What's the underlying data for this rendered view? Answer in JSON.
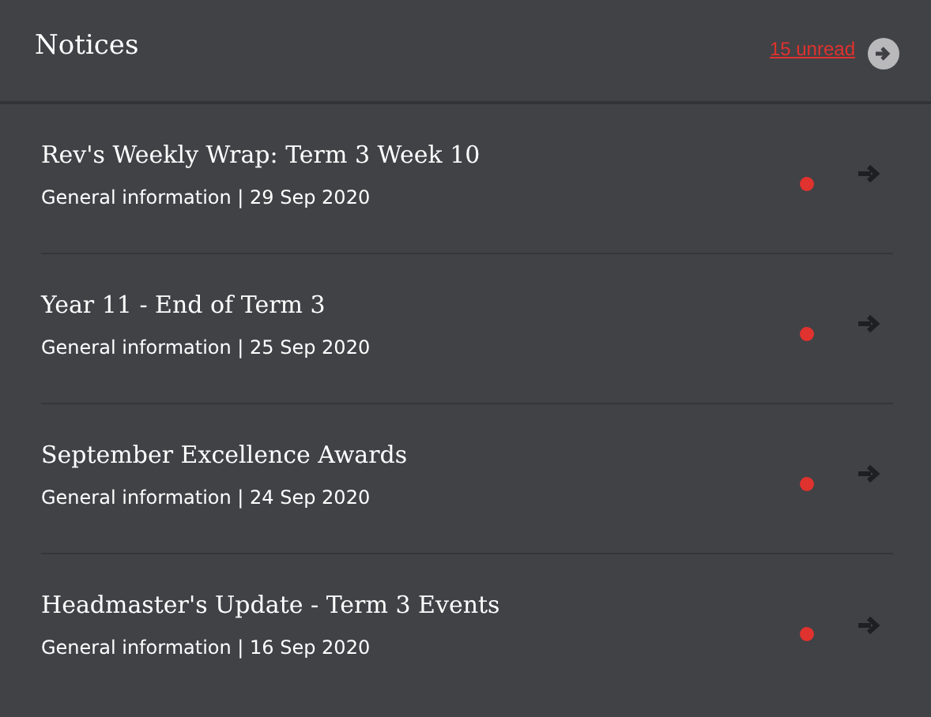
{
  "header": {
    "title": "Notices",
    "unread_link": "15 unread"
  },
  "notices": [
    {
      "title": "Rev's Weekly Wrap: Term 3 Week 10",
      "meta": "General information | 29 Sep 2020",
      "unread": true
    },
    {
      "title": "Year 11 - End of Term 3",
      "meta": "General information | 25 Sep 2020",
      "unread": true
    },
    {
      "title": "September Excellence Awards",
      "meta": "General information | 24 Sep 2020",
      "unread": true
    },
    {
      "title": "Headmaster's Update - Term 3 Events",
      "meta": "General information | 16 Sep 2020",
      "unread": true
    }
  ]
}
